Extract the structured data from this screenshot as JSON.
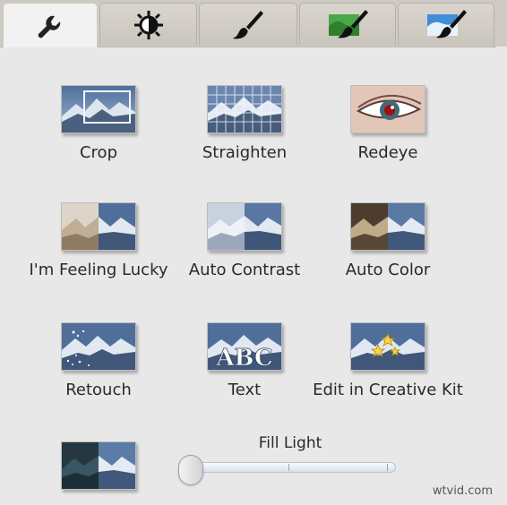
{
  "tabs": [
    {
      "name": "wrench-icon",
      "active": true
    },
    {
      "name": "brightness-icon",
      "active": false
    },
    {
      "name": "brush-icon",
      "active": false
    },
    {
      "name": "green-brush-icon",
      "active": false
    },
    {
      "name": "blue-brush-icon",
      "active": false
    }
  ],
  "tools": {
    "crop": "Crop",
    "straighten": "Straighten",
    "redeye": "Redeye",
    "lucky": "I'm Feeling Lucky",
    "contrast": "Auto Contrast",
    "color": "Auto Color",
    "retouch": "Retouch",
    "text": "Text",
    "creative": "Edit in Creative Kit"
  },
  "text_thumb": "ABC",
  "fill_light": {
    "label": "Fill Light",
    "level": 0.0
  },
  "watermark": "wtvid.com",
  "colors": {
    "tab_bg": "#cfcbc4",
    "active_tab": "#f2f2f2",
    "panel_bg": "#e8e8e8",
    "slider_track": "#dce3ec"
  }
}
